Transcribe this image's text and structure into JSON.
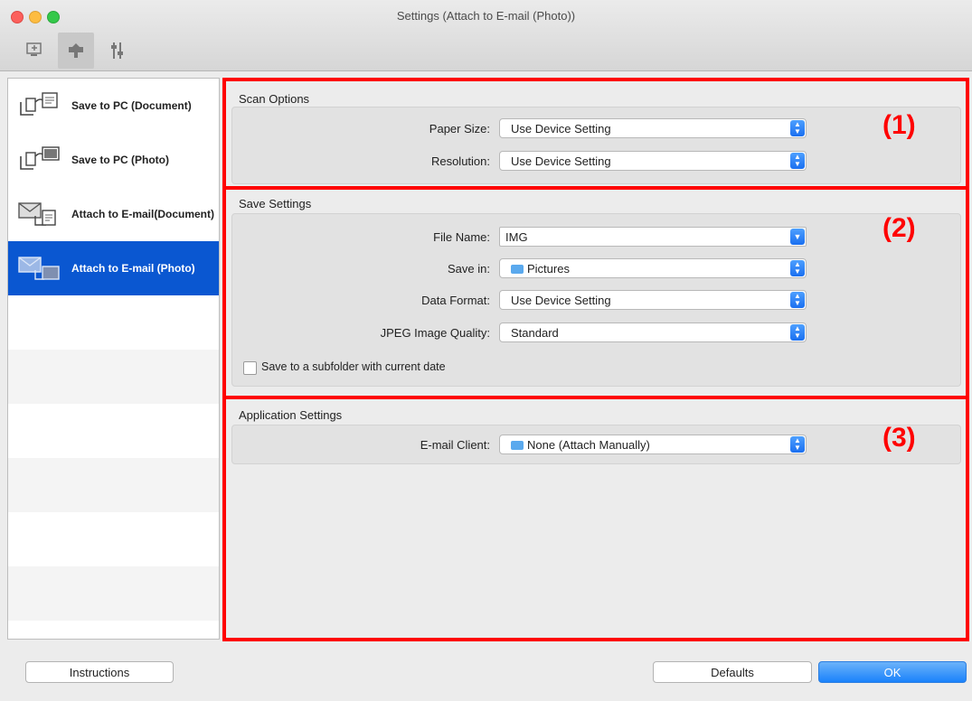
{
  "window": {
    "title": "Settings (Attach to E-mail (Photo))"
  },
  "toolbar": {
    "tabs": [
      {
        "icon": "scan-from-computer-icon"
      },
      {
        "icon": "scan-from-panel-icon"
      },
      {
        "icon": "general-settings-icon"
      }
    ]
  },
  "sidebar": {
    "items": [
      {
        "label": "Save to PC (Document)",
        "icon": "save-document-icon"
      },
      {
        "label": "Save to PC (Photo)",
        "icon": "save-photo-icon"
      },
      {
        "label": "Attach to E-mail (Document)",
        "label_line1": "Attach to E-mail",
        "label_line2": "(Document)",
        "icon": "email-document-icon"
      },
      {
        "label": "Attach to E-mail (Photo)",
        "icon": "email-photo-icon",
        "selected": true
      }
    ]
  },
  "scan_options": {
    "title": "Scan Options",
    "paper_size_label": "Paper Size:",
    "paper_size_value": "Use Device Setting",
    "resolution_label": "Resolution:",
    "resolution_value": "Use Device Setting"
  },
  "save_settings": {
    "title": "Save Settings",
    "file_name_label": "File Name:",
    "file_name_value": "IMG",
    "save_in_label": "Save in:",
    "save_in_value": "Pictures",
    "data_format_label": "Data Format:",
    "data_format_value": "Use Device Setting",
    "jpeg_quality_label": "JPEG Image Quality:",
    "jpeg_quality_value": "Standard",
    "subfolder_label": "Save to a subfolder with current date",
    "subfolder_checked": false
  },
  "application_settings": {
    "title": "Application Settings",
    "email_client_label": "E-mail Client:",
    "email_client_value": "None (Attach Manually)"
  },
  "callouts": {
    "one": "(1)",
    "two": "(2)",
    "three": "(3)"
  },
  "footer": {
    "instructions_label": "Instructions",
    "defaults_label": "Defaults",
    "ok_label": "OK"
  },
  "colors": {
    "accent": "#0a57d1",
    "callout_red": "#ff0000"
  }
}
